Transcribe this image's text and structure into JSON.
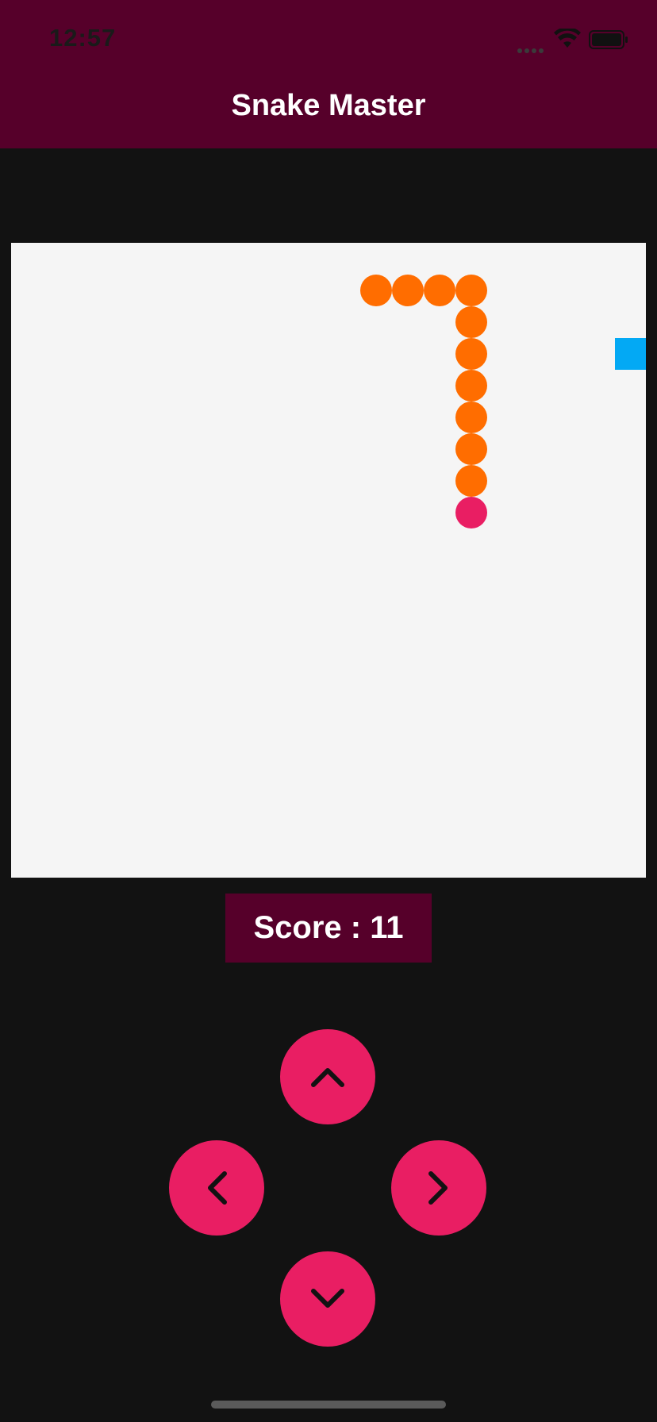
{
  "status_bar": {
    "time": "12:57"
  },
  "header": {
    "title": "Snake Master"
  },
  "game": {
    "snake_body_color": "#ff6d00",
    "snake_head_color": "#e91e63",
    "food_color": "#03a9f4",
    "board_color": "#f5f5f5"
  },
  "score": {
    "label": "Score : 11"
  },
  "controls": {
    "up_icon": "chevron-up-icon",
    "left_icon": "chevron-left-icon",
    "right_icon": "chevron-right-icon",
    "down_icon": "chevron-down-icon",
    "button_color": "#e91e63"
  }
}
